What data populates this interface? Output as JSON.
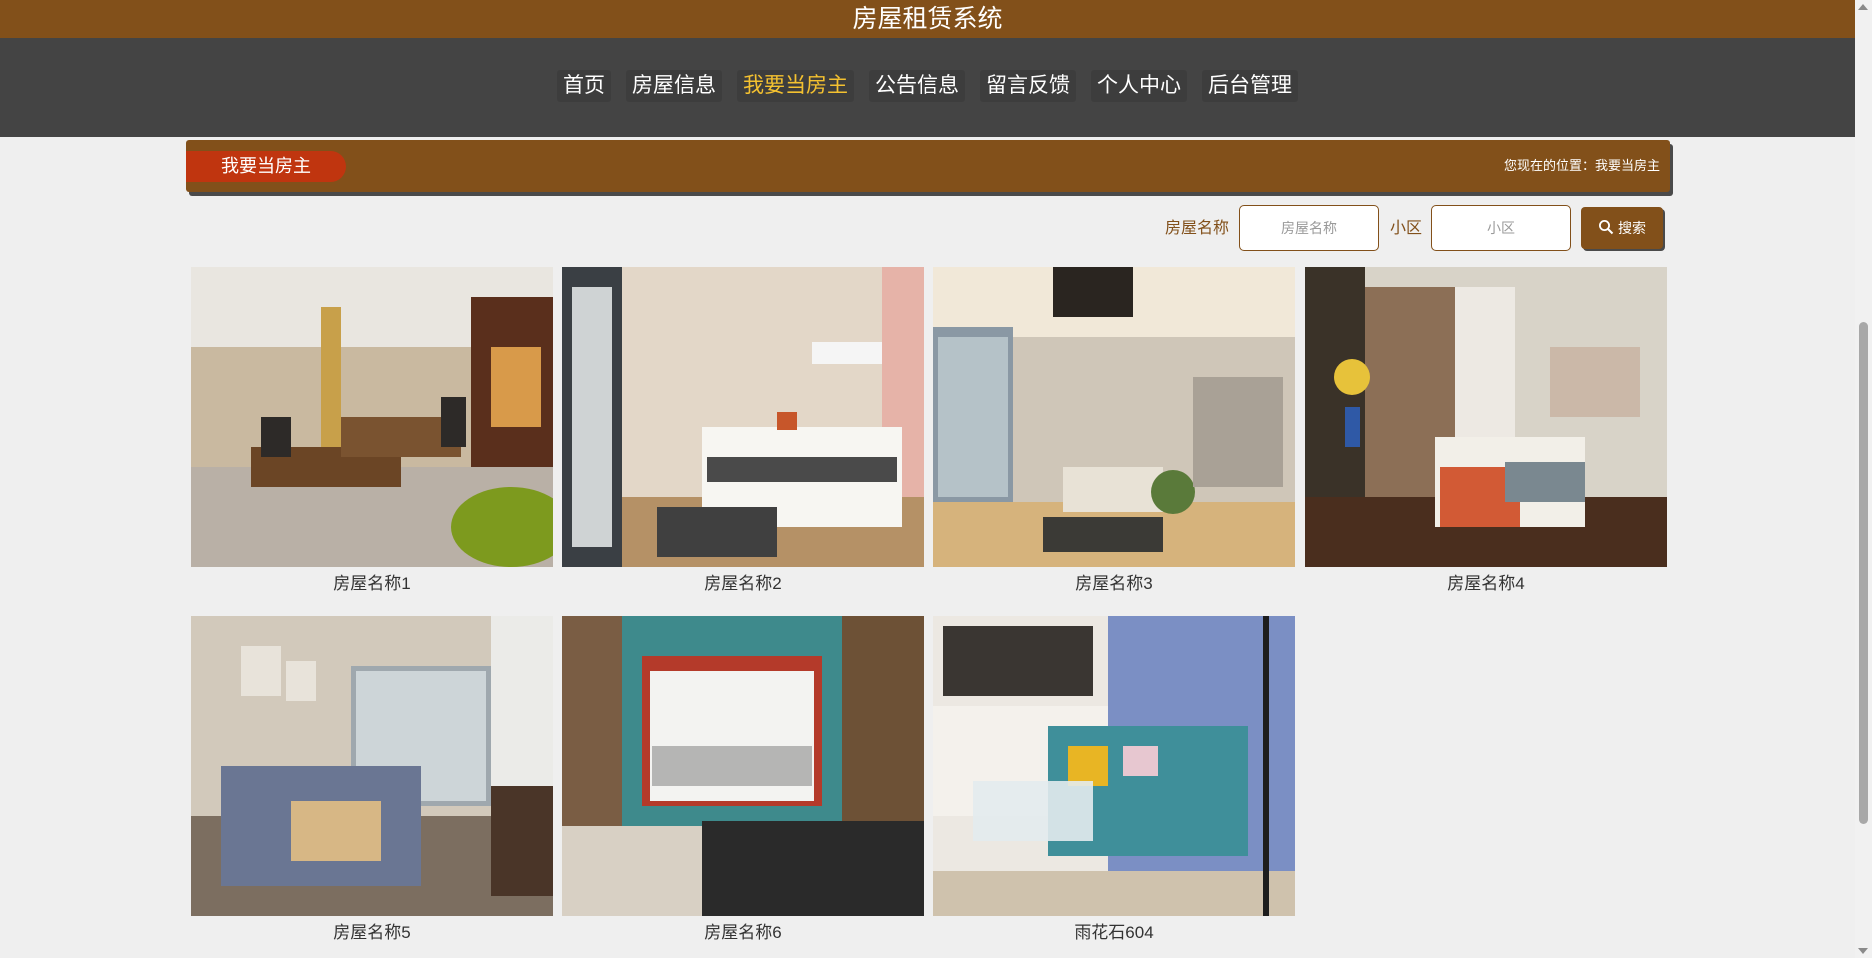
{
  "header": {
    "title": "房屋租赁系统"
  },
  "nav": {
    "items": [
      {
        "label": "首页",
        "active": false
      },
      {
        "label": "房屋信息",
        "active": false
      },
      {
        "label": "我要当房主",
        "active": true
      },
      {
        "label": "公告信息",
        "active": false
      },
      {
        "label": "留言反馈",
        "active": false
      },
      {
        "label": "个人中心",
        "active": false
      },
      {
        "label": "后台管理",
        "active": false
      }
    ]
  },
  "banner": {
    "title": "我要当房主",
    "breadcrumb_prefix": "您现在的位置：",
    "breadcrumb_current": "我要当房主"
  },
  "search": {
    "name_label": "房屋名称",
    "name_placeholder": "房屋名称",
    "community_label": "小区",
    "community_placeholder": "小区",
    "button_label": "搜索",
    "button_icon": "search-icon"
  },
  "listings": [
    {
      "caption": "房屋名称1"
    },
    {
      "caption": "房屋名称2"
    },
    {
      "caption": "房屋名称3"
    },
    {
      "caption": "房屋名称4"
    },
    {
      "caption": "房屋名称5"
    },
    {
      "caption": "房屋名称6"
    },
    {
      "caption": "雨花石604"
    }
  ],
  "colors": {
    "brand_brown": "#82501a",
    "nav_bg": "#444444",
    "nav_active": "#f4c130",
    "banner_pill": "#c0350f",
    "page_bg": "#efefef"
  }
}
